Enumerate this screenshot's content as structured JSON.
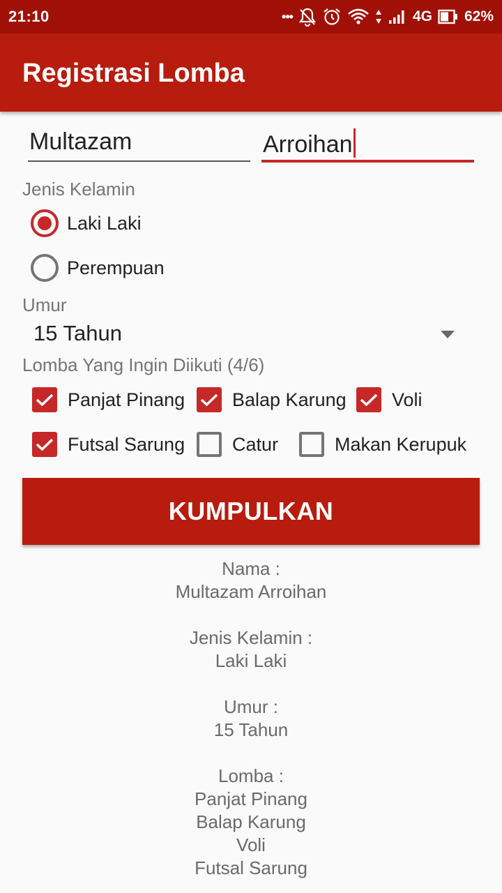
{
  "status_bar": {
    "time": "21:10",
    "dots": "•••",
    "network": "4G",
    "battery": "62%",
    "icons": [
      "notifications-off-icon",
      "alarm-icon",
      "wifi-icon",
      "data-arrows-icon",
      "signal-icon",
      "battery-icon"
    ]
  },
  "app_bar": {
    "title": "Registrasi Lomba"
  },
  "form": {
    "first_name": "Multazam",
    "last_name": "Arroihan",
    "gender_label": "Jenis Kelamin",
    "gender_options": [
      {
        "label": "Laki Laki",
        "selected": true
      },
      {
        "label": "Perempuan",
        "selected": false
      }
    ],
    "age_label": "Umur",
    "age_value": "15 Tahun",
    "contest_label": "Lomba Yang Ingin Diikuti (4/6)",
    "contests": [
      {
        "label": "Panjat Pinang",
        "checked": true
      },
      {
        "label": "Balap Karung",
        "checked": true
      },
      {
        "label": "Voli",
        "checked": true
      },
      {
        "label": "Futsal Sarung",
        "checked": true
      },
      {
        "label": "Catur",
        "checked": false
      },
      {
        "label": "Makan Kerupuk",
        "checked": false
      }
    ],
    "submit_label": "KUMPULKAN"
  },
  "result": {
    "name_label": "Nama :",
    "name_value": "Multazam Arroihan",
    "gender_label": "Jenis Kelamin :",
    "gender_value": "Laki Laki",
    "age_label": "Umur :",
    "age_value": "15 Tahun",
    "contest_label": "Lomba :",
    "contests": [
      "Panjat Pinang",
      "Balap Karung",
      "Voli",
      "Futsal Sarung"
    ]
  },
  "colors": {
    "primary": "#b71c0e",
    "status_bar": "#a11007",
    "accent": "#c62828"
  }
}
